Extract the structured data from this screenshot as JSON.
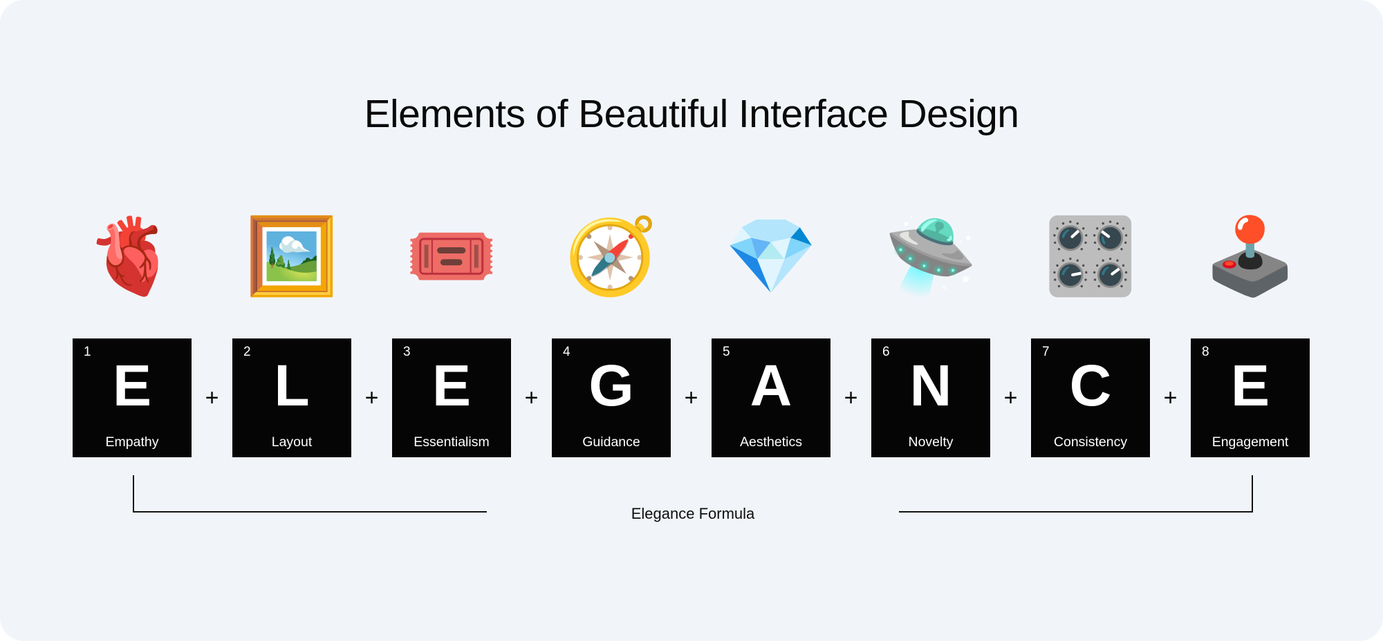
{
  "page": {
    "title": "Elements of Beautiful Interface Design",
    "background_color": "#f1f5f9",
    "tile_color": "#050505",
    "text_color": "#0a0a0a"
  },
  "separator": {
    "symbol": "+"
  },
  "bracket": {
    "label": "Elegance Formula"
  },
  "elements": [
    {
      "number": "1",
      "letter": "E",
      "word": "Empathy",
      "icon": "anatomical-heart-icon",
      "emoji": "🫀"
    },
    {
      "number": "2",
      "letter": "L",
      "word": "Layout",
      "icon": "framed-picture-icon",
      "emoji": "🖼️"
    },
    {
      "number": "3",
      "letter": "E",
      "word": "Essentialism",
      "icon": "admission-ticket-icon",
      "emoji": "🎟️"
    },
    {
      "number": "4",
      "letter": "G",
      "word": "Guidance",
      "icon": "compass-icon",
      "emoji": "🧭"
    },
    {
      "number": "5",
      "letter": "A",
      "word": "Aesthetics",
      "icon": "gem-stone-icon",
      "emoji": "💎"
    },
    {
      "number": "6",
      "letter": "N",
      "word": "Novelty",
      "icon": "flying-saucer-icon",
      "emoji": "🛸"
    },
    {
      "number": "7",
      "letter": "C",
      "word": "Consistency",
      "icon": "control-knobs-icon",
      "emoji": "🎛️"
    },
    {
      "number": "8",
      "letter": "E",
      "word": "Engagement",
      "icon": "joystick-icon",
      "emoji": "🕹️"
    }
  ]
}
